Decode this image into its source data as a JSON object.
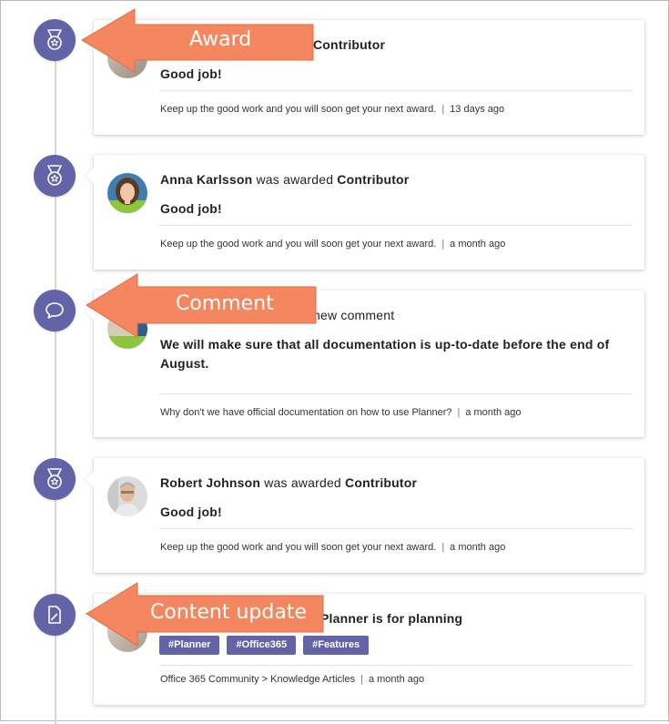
{
  "colors": {
    "accent": "#6264a7",
    "callout": "#f4875f",
    "line": "#d8d8dc"
  },
  "items": [
    {
      "type": "award",
      "icon": "medal-icon",
      "name": "",
      "verb": "",
      "title": "Contributor",
      "body": "Good job!",
      "footer_text": "Keep up the good work and you will soon get your next award.",
      "time": "13 days ago",
      "avatar": "person-avatar"
    },
    {
      "type": "award",
      "icon": "medal-icon",
      "name": "Anna Karlsson",
      "verb": " was awarded ",
      "title": "Contributor",
      "body": "Good job!",
      "footer_text": "Keep up the good work and you will soon get your next award.",
      "time": "a month ago",
      "avatar": "anna-karlsson-avatar"
    },
    {
      "type": "comment",
      "icon": "speech-bubble-icon",
      "headline_tail": "new comment",
      "body": "We will make sure that all documentation is up-to-date before the end of August.",
      "footer_text": "Why don't we have official documentation on how to use Planner?",
      "time": "a month ago",
      "avatar": "person-avatar"
    },
    {
      "type": "award",
      "icon": "medal-icon",
      "name": "Robert Johnson",
      "verb": " was awarded ",
      "title": "Contributor",
      "body": "Good job!",
      "footer_text": "Keep up the good work and you will soon get your next award.",
      "time": "a month ago",
      "avatar": "robert-johnson-avatar"
    },
    {
      "type": "content-update",
      "icon": "edit-document-icon",
      "headline_tail": "Planner is for planning",
      "tags": [
        "#Planner",
        "#Office365",
        "#Features"
      ],
      "footer_text": "Office 365 Community > Knowledge Articles",
      "time": "a month ago",
      "avatar": "person-avatar"
    }
  ],
  "footer_separator": "|",
  "callouts": {
    "award": "Award",
    "comment": "Comment",
    "content_update": "Content update"
  }
}
